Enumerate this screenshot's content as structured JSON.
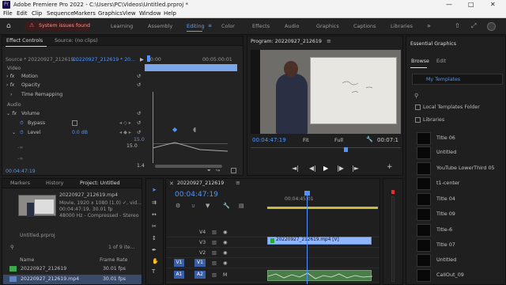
{
  "app": {
    "title": "Adobe Premiere Pro 2022 - C:\\Users\\PC\\Videos\\Untitled.prproj *",
    "logo": "Pr"
  },
  "menu": [
    "File",
    "Edit",
    "Clip",
    "Sequence",
    "Markers",
    "Graphics",
    "View",
    "Window",
    "Help"
  ],
  "workspace": {
    "issues": "System issues found",
    "tabs": [
      "Learning",
      "Assembly",
      "Editing",
      "Color",
      "Effects",
      "Audio",
      "Graphics",
      "Captions",
      "Libraries"
    ],
    "active": "Editing"
  },
  "effect_controls": {
    "tab": "Effect Controls",
    "source_tab": "Source: (no clips)",
    "source_sel": "Source * 20220927_212619...",
    "seq_sel": "20220927_212619 * 20...",
    "tc_start": "00:00",
    "tc_end": "00:05:00:01",
    "video_label": "Video",
    "motion": "Motion",
    "opacity": "Opacity",
    "time_remap": "Time Remapping",
    "audio_label": "Audio",
    "volume": "Volume",
    "bypass": "Bypass",
    "level": "Level",
    "level_val": "0.0 dB",
    "graph_top": "15.0",
    "graph_mid": "15.0",
    "graph_low_l": "-∞",
    "graph_low_r": "-∞",
    "graph_bot": "1.4",
    "timecode": "00:04:47:19"
  },
  "program": {
    "title": "Program: 20220927_212619",
    "timecode": "00:04:47:19",
    "fit": "Fit",
    "quality": "Full",
    "tc_right": "00:07:1"
  },
  "project": {
    "tabs": [
      "Markers",
      "History",
      "Project: Untitled"
    ],
    "file": "20220927_212619.mp4",
    "line1": "Movie, 1920 x 1080 (1.0)  ✓, vid...",
    "line2": "00:04:47:19, 30.01 fp",
    "line3": "48000 Hz - Compressed - Stereo",
    "proj_file": "Untitled.prproj",
    "count": "1 of 9 ite...",
    "col_name": "Name",
    "col_rate": "Frame Rate",
    "items": [
      {
        "name": "20220927_212619",
        "rate": "30.01 fps"
      },
      {
        "name": "20220927_212619.mp4",
        "rate": "30.01 fps"
      }
    ]
  },
  "timeline": {
    "tab": "20220927_212619",
    "timecode": "00:04:47:19",
    "ruler": "00:04:45:01",
    "tracks": [
      "V4",
      "V3",
      "V2",
      "V1",
      "A1",
      "A2"
    ],
    "clip_label": "20220927_212619.mp4 [V]"
  },
  "essential": {
    "title": "Essential Graphics",
    "tabs": [
      "Browse",
      "Edit"
    ],
    "dropdown": "My Templates",
    "local": "Local Templates Folder",
    "libraries": "Libraries",
    "items": [
      "Title 06",
      "Untitled",
      "YouTube LowerThird 05",
      "t1-center",
      "Title 04",
      "Title 09",
      "Title-6",
      "Title 07",
      "Untitled",
      "CallOut_09"
    ]
  }
}
